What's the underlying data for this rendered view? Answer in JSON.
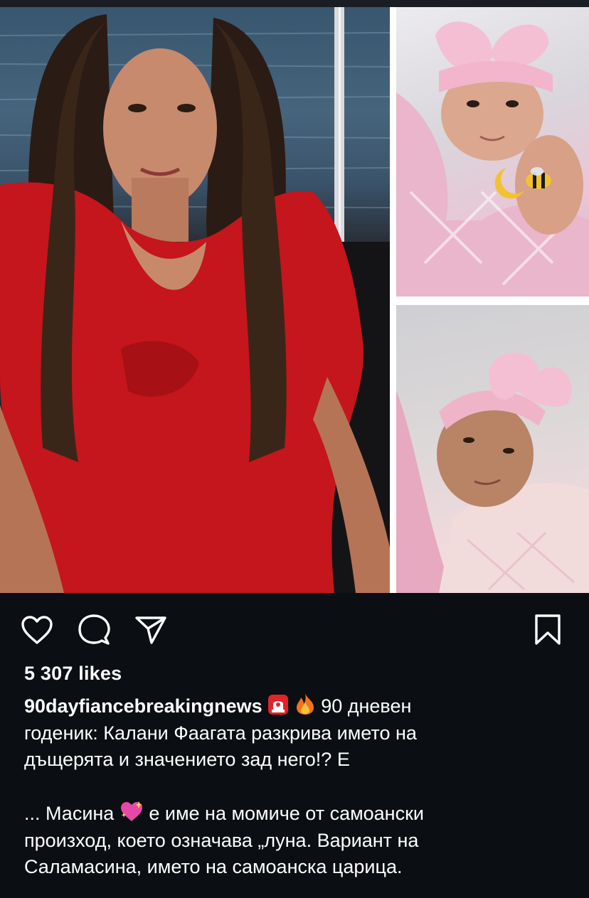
{
  "post": {
    "likes_text": "5 307 likes",
    "username": "90dayfiancebreakingnews",
    "caption_icons": [
      "rotating-light-icon",
      "fire-icon"
    ],
    "caption_line1_rest": "90 дневен",
    "caption_line2": "годеник: Калани Фаагата разкрива името на",
    "caption_line3": "дъщерята и значението зад него!? Е",
    "caption_p2_start": "... Масина",
    "caption_p2_icon": "sparkling-heart-icon",
    "caption_p2_rest": "е име на момиче от самоански",
    "caption_p2_line2": "произход, което означава „луна. Вариант на",
    "caption_p2_line3": "Саламасина, името на самоанска царица."
  },
  "actions": {
    "like_icon": "heart-outline-icon",
    "comment_icon": "comment-bubble-icon",
    "share_icon": "paper-plane-icon",
    "save_icon": "bookmark-icon"
  },
  "colors": {
    "background": "#0b0e12",
    "text": "#ffffff",
    "dress_red": "#c4161c",
    "baby_pink": "#e9b6cb"
  }
}
